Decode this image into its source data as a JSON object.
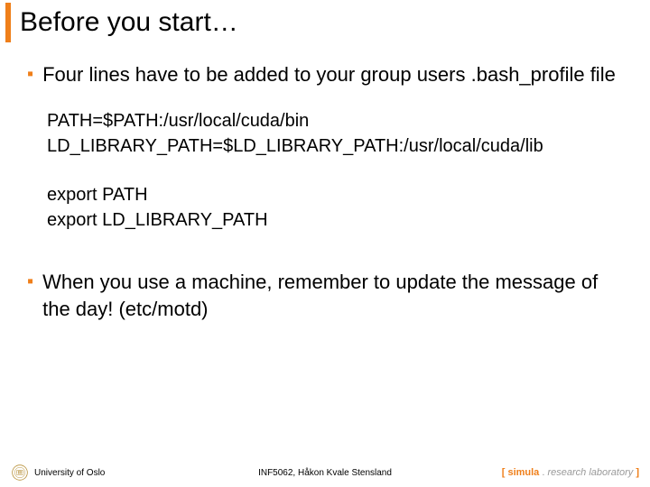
{
  "title": "Before you start…",
  "bullets": [
    "Four lines have to be added to your group users .bash_profile file",
    "When you use a machine, remember to update the message of the day! (etc/motd)"
  ],
  "code": {
    "line1": "PATH=$PATH:/usr/local/cuda/bin",
    "line2": "LD_LIBRARY_PATH=$LD_LIBRARY_PATH:/usr/local/cuda/lib",
    "line3": "export PATH",
    "line4": "export LD_LIBRARY_PATH"
  },
  "footer": {
    "university": "University of Oslo",
    "course": "INF5062, Håkon Kvale Stensland",
    "simula_bracket_open": "[ ",
    "simula_word": "simula",
    "simula_dot": " . ",
    "simula_research": "research laboratory",
    "simula_bracket_close": " ]"
  }
}
